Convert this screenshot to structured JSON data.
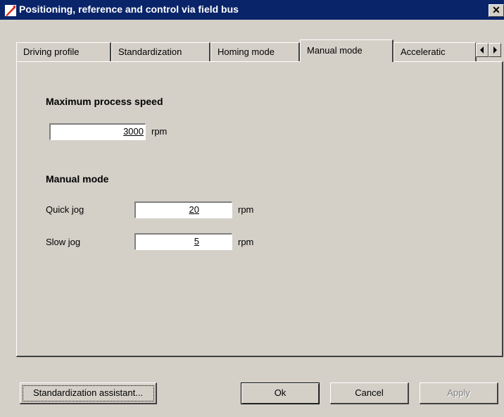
{
  "window": {
    "title": "Positioning, reference and control via field bus",
    "close_label": "✕"
  },
  "tabs": [
    {
      "label": "Driving profile",
      "active": false
    },
    {
      "label": "Standardization",
      "active": false
    },
    {
      "label": "Homing mode",
      "active": false
    },
    {
      "label": "Manual mode",
      "active": true
    },
    {
      "label": "Acceleratic",
      "active": false
    }
  ],
  "max_speed": {
    "heading": "Maximum process speed",
    "value": "3000",
    "unit": "rpm"
  },
  "manual": {
    "heading": "Manual mode",
    "quick_label": "Quick jog",
    "quick_value": "20",
    "quick_unit": "rpm",
    "slow_label": "Slow jog",
    "slow_value": "5",
    "slow_unit": "rpm"
  },
  "buttons": {
    "assistant": "Standardization assistant...",
    "ok": "Ok",
    "cancel": "Cancel",
    "apply": "Apply"
  }
}
